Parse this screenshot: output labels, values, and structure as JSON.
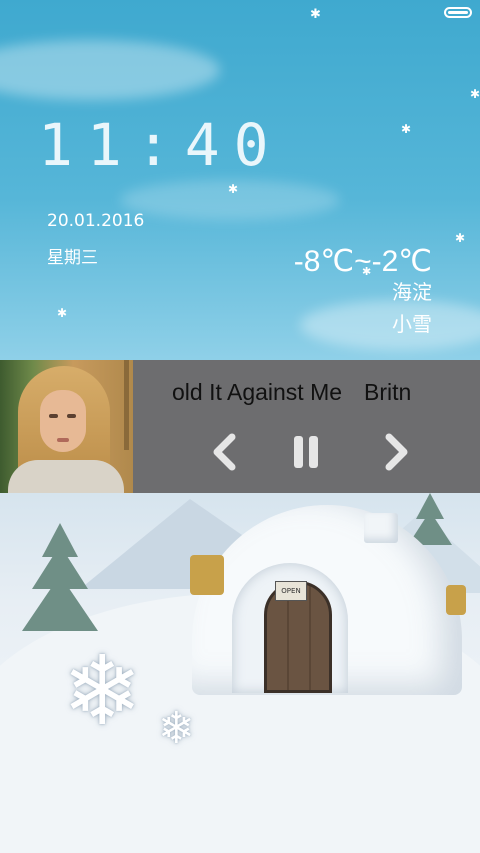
{
  "status_bar": {
    "battery_icon": "battery-full-icon"
  },
  "lockscreen": {
    "time": "11:40",
    "date": "20.01.2016",
    "weekday": "星期三"
  },
  "weather": {
    "temperature_range": "-8℃~-2℃",
    "location": "海淀",
    "condition": "小雪"
  },
  "music_player": {
    "track_text_visible": "old It Against Me",
    "artist_text_visible": "Britn",
    "controls": {
      "previous_icon": "chevron-left-icon",
      "pause_icon": "pause-icon",
      "next_icon": "chevron-right-icon"
    }
  },
  "scene": {
    "door_sign": "OPEN"
  },
  "colors": {
    "sky": "#3fa9cf",
    "player_bg": "#6d6d6f",
    "text": "#ffffff"
  }
}
